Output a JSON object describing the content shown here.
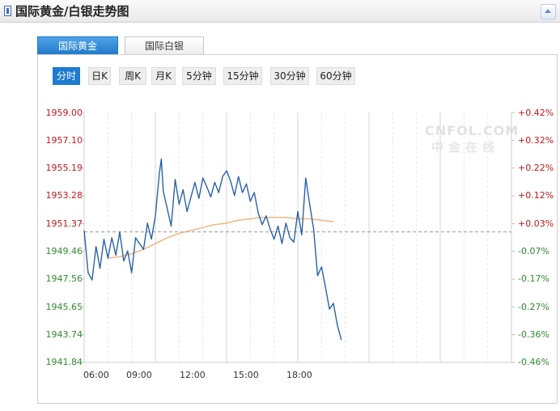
{
  "header": {
    "title": "国际黄金/白银走势图"
  },
  "tabs": [
    {
      "label": "国际黄金",
      "active": true
    },
    {
      "label": "国际白银",
      "active": false
    }
  ],
  "periods": [
    {
      "label": "分时",
      "active": true
    },
    {
      "label": "日K",
      "active": false
    },
    {
      "label": "周K",
      "active": false
    },
    {
      "label": "月K",
      "active": false
    },
    {
      "label": "5分钟",
      "active": false
    },
    {
      "label": "15分钟",
      "active": false
    },
    {
      "label": "30分钟",
      "active": false
    },
    {
      "label": "60分钟",
      "active": false
    }
  ],
  "watermark": {
    "brand": "CNFOL.COM",
    "cn": "中金在线"
  },
  "colors": {
    "price_line": "#2a62a8",
    "avg_line": "#f0b27a",
    "up": "#c4161c",
    "down": "#2f8a2f",
    "ref_line": "#999999"
  },
  "chart_data": {
    "type": "line",
    "y_ticks": [
      "1959.00",
      "1957.10",
      "1955.19",
      "1953.28",
      "1951.37",
      "1949.46",
      "1947.56",
      "1945.65",
      "1943.74",
      "1941.84"
    ],
    "pct_ticks": [
      "+0.42%",
      "+0.32%",
      "+0.22%",
      "+0.12%",
      "+0.03%",
      "-0.07%",
      "-0.17%",
      "-0.27%",
      "-0.36%",
      "-0.46%"
    ],
    "x_ticks": [
      "06:00",
      "09:00",
      "12:00",
      "15:00",
      "18:00"
    ],
    "ylim": [
      1941.84,
      1959.0
    ],
    "xlim": [
      "06:00",
      "24:00"
    ],
    "reference_price": 1950.8,
    "series": [
      {
        "role": "price",
        "x": [
          "06:00",
          "06:10",
          "06:20",
          "06:30",
          "06:40",
          "06:50",
          "07:00",
          "07:10",
          "07:20",
          "07:30",
          "07:40",
          "07:50",
          "08:00",
          "08:10",
          "08:20",
          "08:30",
          "08:40",
          "08:50",
          "09:00",
          "09:10",
          "09:15",
          "09:20",
          "09:30",
          "09:40",
          "09:50",
          "10:00",
          "10:10",
          "10:20",
          "10:30",
          "10:40",
          "10:50",
          "11:00",
          "11:10",
          "11:20",
          "11:30",
          "11:40",
          "11:50",
          "12:00",
          "12:10",
          "12:20",
          "12:30",
          "12:40",
          "12:50",
          "13:00",
          "13:10",
          "13:20",
          "13:30",
          "13:40",
          "13:50",
          "14:00",
          "14:10",
          "14:20",
          "14:30",
          "14:40",
          "14:50",
          "15:00",
          "15:10",
          "15:20",
          "15:30",
          "15:40",
          "15:50",
          "16:00",
          "16:10",
          "16:20",
          "16:30",
          "16:40",
          "16:50"
        ],
        "values": [
          1950.9,
          1948.0,
          1947.5,
          1949.8,
          1948.3,
          1950.3,
          1949.0,
          1950.4,
          1949.2,
          1950.8,
          1948.8,
          1949.5,
          1948.0,
          1950.4,
          1950.0,
          1949.6,
          1951.4,
          1950.3,
          1951.9,
          1954.8,
          1955.8,
          1953.6,
          1952.4,
          1951.2,
          1954.4,
          1952.7,
          1953.7,
          1952.2,
          1953.2,
          1954.2,
          1953.1,
          1954.5,
          1953.9,
          1953.2,
          1954.2,
          1953.5,
          1954.6,
          1955.0,
          1954.3,
          1953.3,
          1954.6,
          1953.5,
          1954.1,
          1952.9,
          1953.5,
          1952.1,
          1951.3,
          1951.9,
          1951.0,
          1950.3,
          1951.2,
          1950.0,
          1951.4,
          1950.4,
          1950.1,
          1952.2,
          1950.6,
          1954.5,
          1952.7,
          1951.0,
          1947.8,
          1948.4,
          1947.0,
          1945.5,
          1945.9,
          1944.4,
          1943.4
        ]
      },
      {
        "role": "average",
        "x": [
          "07:00",
          "07:30",
          "08:00",
          "08:30",
          "09:00",
          "09:30",
          "10:00",
          "10:30",
          "11:00",
          "11:30",
          "12:00",
          "12:30",
          "13:00",
          "13:30",
          "14:00",
          "14:30",
          "15:00",
          "15:30",
          "16:00",
          "16:30"
        ],
        "values": [
          1949.0,
          1949.1,
          1949.3,
          1949.6,
          1950.0,
          1950.4,
          1950.7,
          1950.9,
          1951.1,
          1951.3,
          1951.4,
          1951.6,
          1951.7,
          1951.8,
          1951.8,
          1951.8,
          1951.7,
          1951.7,
          1951.6,
          1951.5
        ]
      }
    ]
  }
}
